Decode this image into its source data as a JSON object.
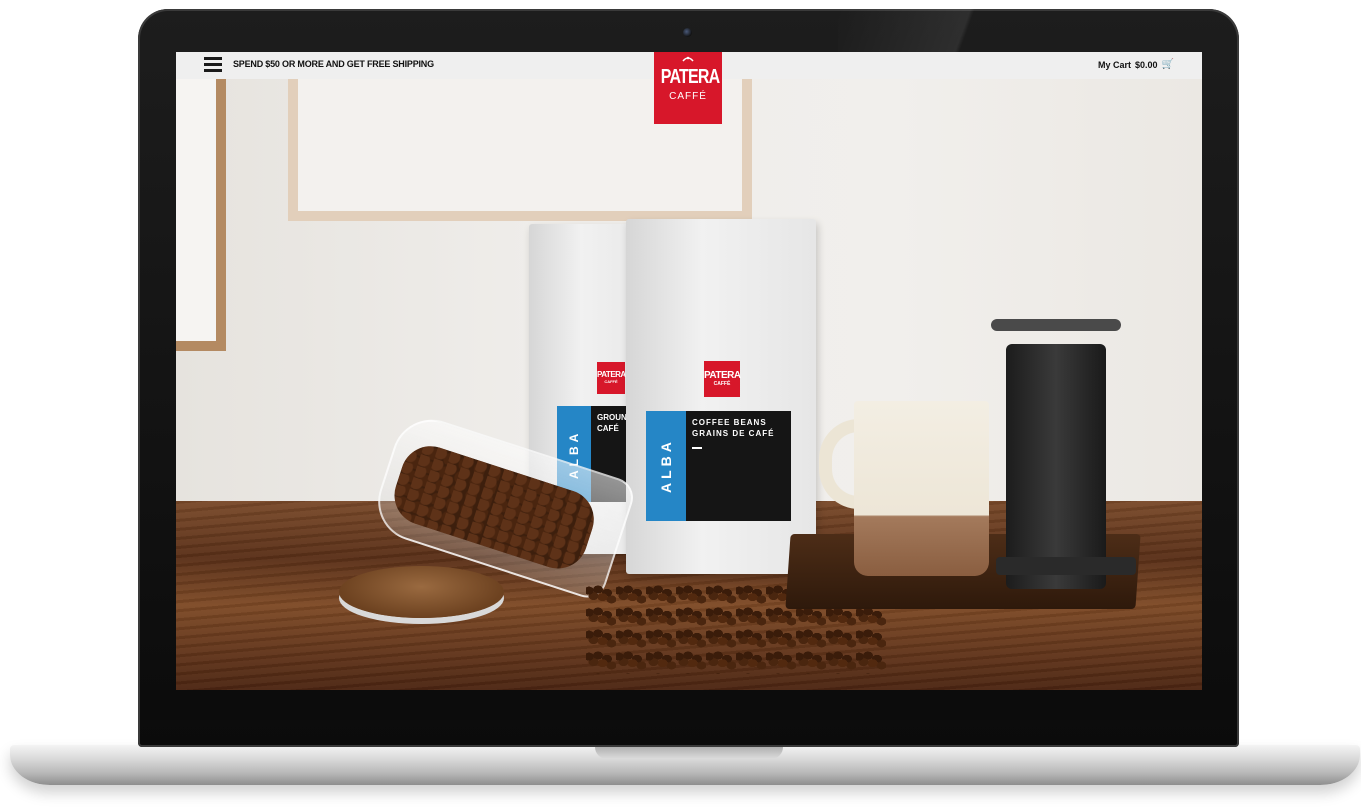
{
  "topbar": {
    "promo_text": "SPEND $50 OR MORE AND GET FREE SHIPPING",
    "cart_label": "My Cart",
    "cart_total": "$0.00",
    "menu_icon": "hamburger-menu-icon",
    "cart_icon": "shopping-cart-icon"
  },
  "logo": {
    "name": "PATERA",
    "subtitle": "CAFFÉ"
  },
  "hero": {
    "front_bag": {
      "logo_name": "PATERA",
      "logo_sub": "CAFFÉ",
      "side_label": "ALBA",
      "title_line1": "COFFEE BEANS",
      "title_line2": "GRAINS DE CAFÉ"
    },
    "back_bag": {
      "logo_name": "PATERA",
      "logo_sub": "CAFFÉ",
      "side_label": "ALBA",
      "title_line1": "GROUND",
      "title_line2": "CAFÉ"
    }
  },
  "colors": {
    "brand_red": "#d7172a",
    "label_blue": "#2586c6",
    "topbar_bg": "#efefef"
  }
}
